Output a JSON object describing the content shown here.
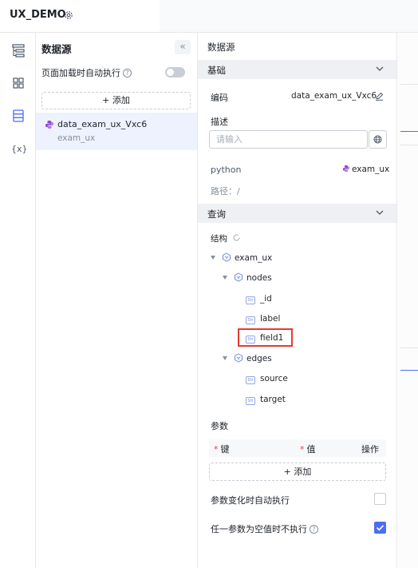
{
  "app": {
    "title": "UX_DEMO"
  },
  "sidebar": {
    "icons": [
      "tree-outline-icon",
      "grid-icon",
      "datasource-icon",
      "variable-icon"
    ],
    "variable_glyph": "{x}"
  },
  "datasource_panel": {
    "title": "数据源",
    "collapse_glyph": "«",
    "autorun_label": "页面加载时自动执行",
    "autorun_enabled": false,
    "add_label": "+ 添加",
    "items": [
      {
        "name": "data_exam_ux_Vxc6",
        "subtitle": "exam_ux"
      }
    ]
  },
  "properties": {
    "title": "数据源",
    "basic": {
      "header": "基础",
      "code_label": "编码",
      "code_value": "data_exam_ux_Vxc6",
      "desc_label": "描述",
      "desc_placeholder": "请输入",
      "type_label": "python",
      "type_value": "exam_ux",
      "path_label": "路径：/"
    },
    "query": {
      "header": "查询",
      "structure_label": "结构",
      "tree": {
        "root": "exam_ux",
        "nodes_label": "nodes",
        "nodes_fields": [
          "_id",
          "label",
          "field1"
        ],
        "edges_label": "edges",
        "edges_fields": [
          "source",
          "target"
        ],
        "str_badge": "Str",
        "highlighted_field": "field1"
      },
      "params_label": "参数",
      "params_columns": {
        "key": "键",
        "value": "值",
        "action": "操作"
      },
      "params_required_mark": "*",
      "add_param_label": "+ 添加",
      "autorun_on_change_label": "参数变化时自动执行",
      "autorun_on_change": false,
      "skip_empty_label": "任一参数为空值时不执行",
      "skip_empty": true
    }
  },
  "colors": {
    "accent": "#4e6ef2",
    "highlight": "#e53935",
    "python": "#8a45d6"
  }
}
